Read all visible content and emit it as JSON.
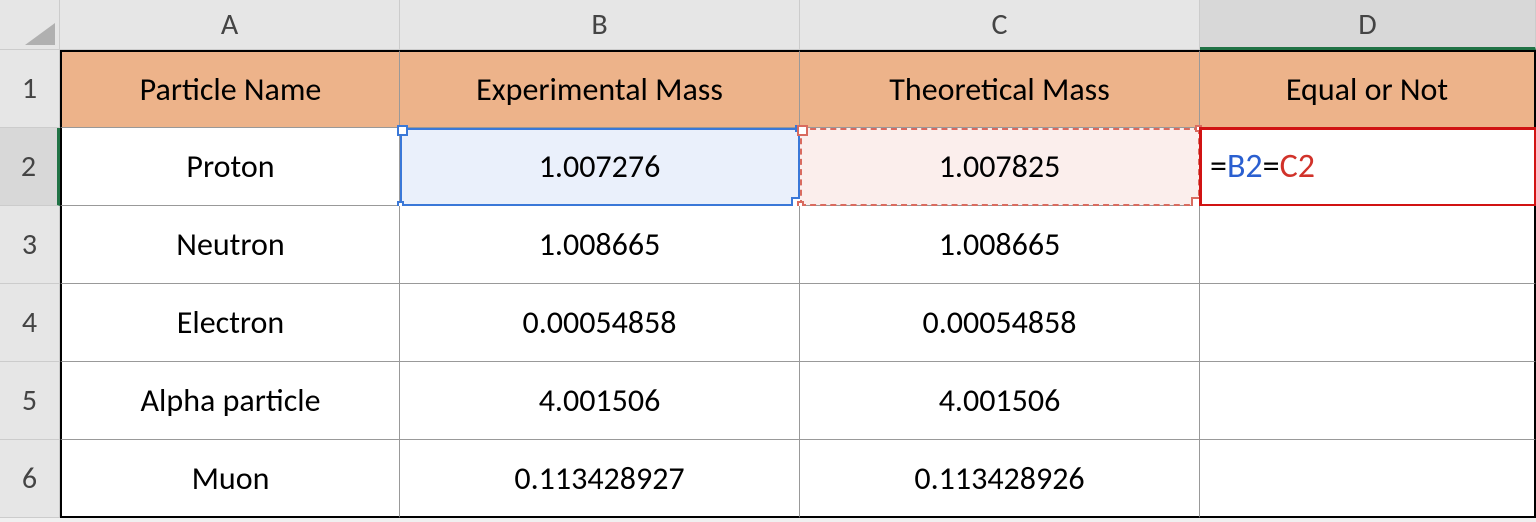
{
  "columns": {
    "A": "A",
    "B": "B",
    "C": "C",
    "D": "D"
  },
  "row_numbers": [
    "1",
    "2",
    "3",
    "4",
    "5",
    "6"
  ],
  "headers": {
    "A": "Particle Name",
    "B": "Experimental Mass",
    "C": "Theoretical Mass",
    "D": "Equal or Not"
  },
  "rows": [
    {
      "name": "Proton",
      "exp": "1.007276",
      "theo": "1.007825"
    },
    {
      "name": "Neutron",
      "exp": "1.008665",
      "theo": "1.008665"
    },
    {
      "name": "Electron",
      "exp": "0.00054858",
      "theo": "0.00054858"
    },
    {
      "name": "Alpha particle",
      "exp": "4.001506",
      "theo": "4.001506"
    },
    {
      "name": "Muon",
      "exp": "0.113428927",
      "theo": "0.113428926"
    }
  ],
  "formula": {
    "eq1": "=",
    "refB": "B2",
    "eq2": "=",
    "refC": "C2"
  }
}
